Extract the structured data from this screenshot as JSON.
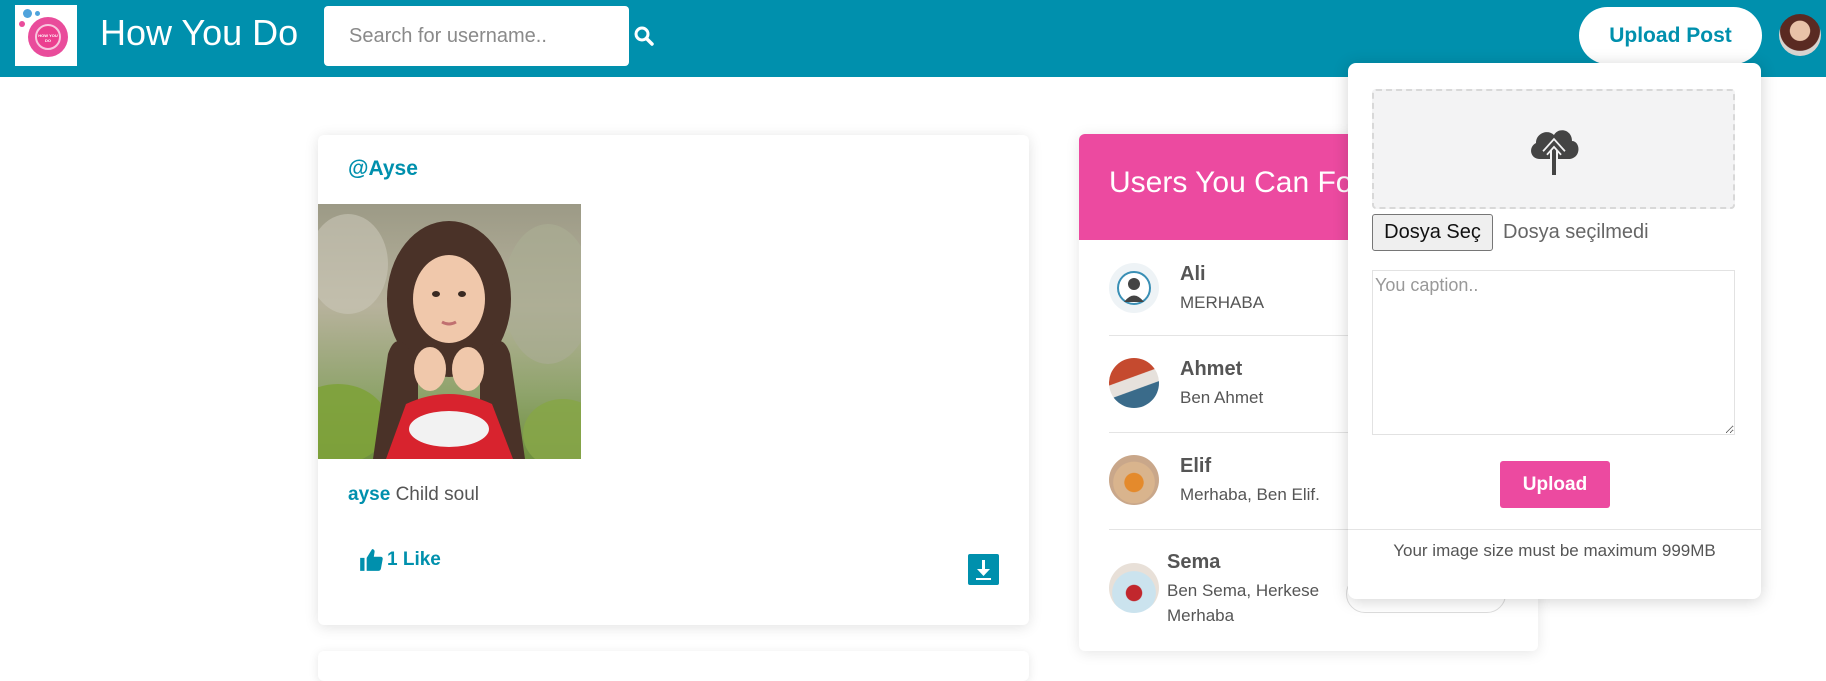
{
  "header": {
    "brand": "How You Do",
    "search_placeholder": "Search for username..",
    "upload_post_label": "Upload Post",
    "logo_text": "HOW YOU DO",
    "accent_color": "#0090ad"
  },
  "post": {
    "username_handle": "@Ayse",
    "caption_user": "ayse",
    "caption_text": "Child soul",
    "like_label": "1 Like"
  },
  "suggestions": {
    "title": "Users You Can Fo",
    "users": [
      {
        "name": "Ali",
        "bio": "MERHABA"
      },
      {
        "name": "Ahmet",
        "bio": "Ben Ahmet"
      },
      {
        "name": "Elif",
        "bio": "Merhaba, Ben Elif."
      },
      {
        "name": "Sema",
        "bio": "Ben Sema, Herkese Merhaba"
      }
    ],
    "header_color": "#ec4aa0"
  },
  "upload_popup": {
    "file_button_label": "Dosya Seç",
    "file_status": "Dosya seçilmedi",
    "caption_placeholder": "You caption..",
    "upload_button_label": "Upload",
    "note": "Your image size must be maximum 999MB"
  }
}
